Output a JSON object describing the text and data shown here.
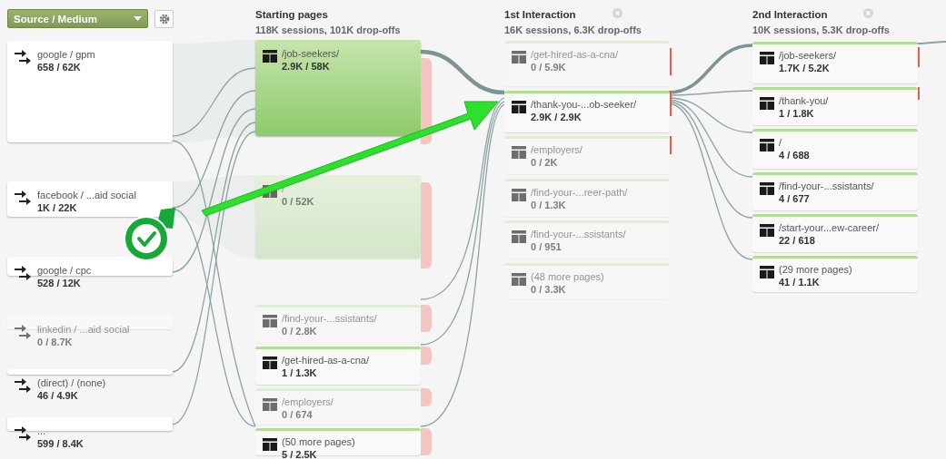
{
  "dimension": {
    "label": "Source / Medium"
  },
  "sources": [
    {
      "name": "google / gpm",
      "stats": "658 / 62K",
      "dimmed": false
    },
    {
      "name": "facebook / ...aid social",
      "stats": "1K / 22K",
      "dimmed": false
    },
    {
      "name": "google / cpc",
      "stats": "528 / 12K",
      "dimmed": false
    },
    {
      "name": "linkedin / ...aid social",
      "stats": "0 / 8.7K",
      "dimmed": true
    },
    {
      "name": "(direct) / (none)",
      "stats": "46 / 4.9K",
      "dimmed": false
    },
    {
      "name": "...",
      "stats": "599 / 8.4K",
      "dimmed": false
    }
  ],
  "steps": [
    {
      "title": "Starting pages",
      "summary": "118K sessions, 101K drop-offs",
      "nodes": [
        {
          "page": "/job-seekers/",
          "stats": "2.9K / 58K",
          "dimmed": false,
          "highlighted": true
        },
        {
          "page": "/",
          "stats": "0 / 52K",
          "dimmed": true,
          "highlighted": true
        },
        {
          "page": "/find-your-...ssistants/",
          "stats": "0 / 2.8K",
          "dimmed": true,
          "highlighted": false
        },
        {
          "page": "/get-hired-as-a-cna/",
          "stats": "1 / 1.3K",
          "dimmed": false,
          "highlighted": false
        },
        {
          "page": "/employers/",
          "stats": "0 / 674",
          "dimmed": true,
          "highlighted": false
        },
        {
          "page": "(50 more pages)",
          "stats": "5 / 2.5K",
          "dimmed": false,
          "highlighted": false
        }
      ]
    },
    {
      "title": "1st Interaction",
      "summary": "16K sessions, 6.3K drop-offs",
      "closable": true,
      "nodes": [
        {
          "page": "/get-hired-as-a-cna/",
          "stats": "0 / 5.9K",
          "dimmed": true,
          "highlighted": false
        },
        {
          "page": "/thank-you-...ob-seeker/",
          "stats": "2.9K / 2.9K",
          "dimmed": false,
          "highlighted": false
        },
        {
          "page": "/employers/",
          "stats": "0 / 2K",
          "dimmed": true,
          "highlighted": false
        },
        {
          "page": "/find-your-...reer-path/",
          "stats": "0 / 1.3K",
          "dimmed": true,
          "highlighted": false
        },
        {
          "page": "/find-your-...ssistants/",
          "stats": "0 / 951",
          "dimmed": true,
          "highlighted": false
        },
        {
          "page": "(48 more pages)",
          "stats": "0 / 3.3K",
          "dimmed": true,
          "highlighted": false
        }
      ]
    },
    {
      "title": "2nd Interaction",
      "summary": "10K sessions, 5.3K drop-offs",
      "closable": true,
      "nodes": [
        {
          "page": "/job-seekers/",
          "stats": "1.7K / 5.2K",
          "dimmed": false,
          "highlighted": false
        },
        {
          "page": "/thank-you/",
          "stats": "1 / 1.8K",
          "dimmed": false,
          "highlighted": false
        },
        {
          "page": "/",
          "stats": "4 / 688",
          "dimmed": false,
          "highlighted": false
        },
        {
          "page": "/find-your-...ssistants/",
          "stats": "4 / 677",
          "dimmed": false,
          "highlighted": false
        },
        {
          "page": "/start-your...ew-career/",
          "stats": "22 / 618",
          "dimmed": false,
          "highlighted": false
        },
        {
          "page": "(29 more pages)",
          "stats": "41 / 1.1K",
          "dimmed": false,
          "highlighted": false
        }
      ]
    }
  ]
}
